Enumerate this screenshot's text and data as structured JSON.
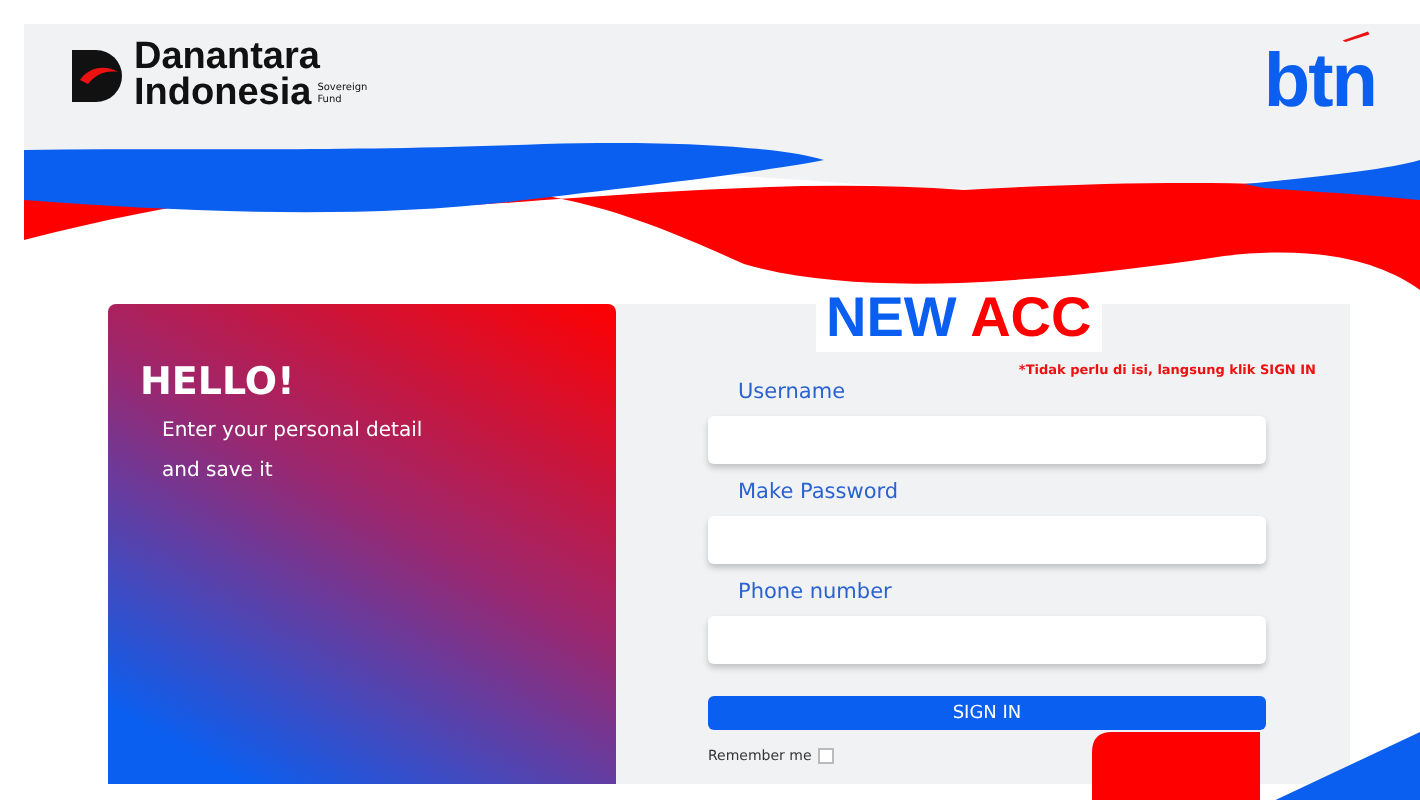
{
  "header": {
    "logo_left": {
      "line_1": "Danantara",
      "line_2": "Indonesia",
      "tag_1": "Sovereign",
      "tag_2": "Fund"
    },
    "logo_right": "btn"
  },
  "panel": {
    "heading": "HELLO!",
    "text_1": "Enter your personal detail",
    "text_2": "and save it"
  },
  "form": {
    "title_1": "NEW",
    "title_2": "ACC",
    "note": "*Tidak perlu di isi, langsung klik SIGN IN",
    "fields": [
      {
        "label": "Username"
      },
      {
        "label": "Make Password"
      },
      {
        "label": "Phone number"
      }
    ],
    "button": "SIGN IN",
    "remember": {
      "label": "Remember me",
      "checked": false
    }
  }
}
